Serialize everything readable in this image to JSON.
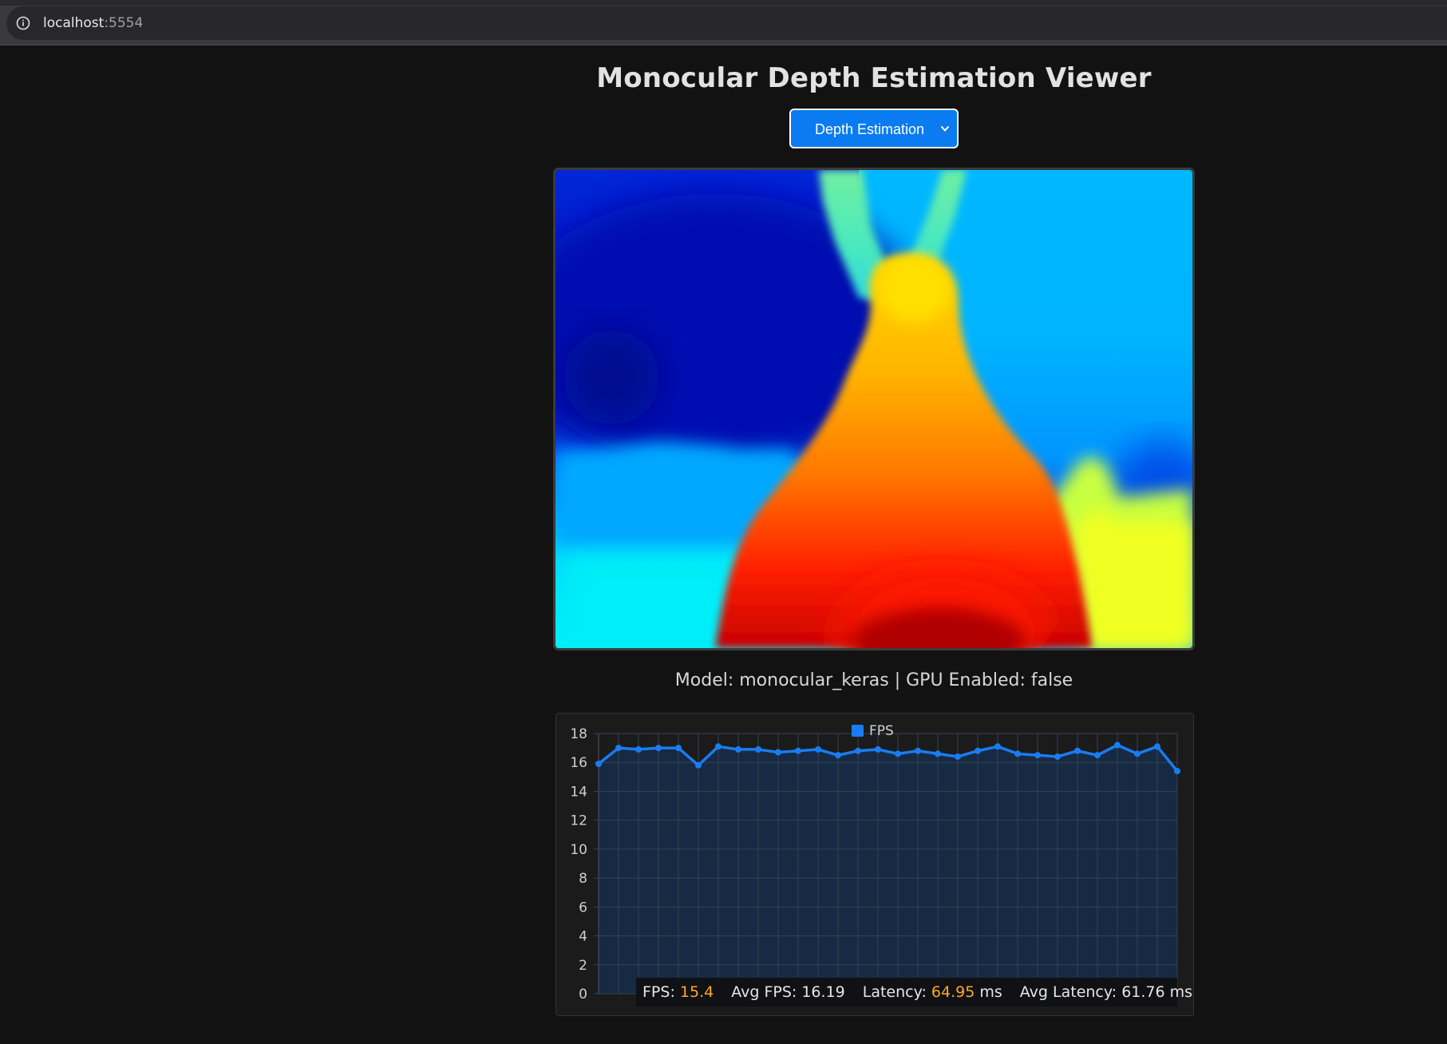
{
  "browser": {
    "url_host": "localhost",
    "url_port": ":5554"
  },
  "page": {
    "title": "Monocular Depth Estimation Viewer"
  },
  "mode_select": {
    "selected": "Depth Estimation"
  },
  "model_info": {
    "model_label": "Model:",
    "model_value": "monocular_keras",
    "separator": "|",
    "gpu_label": "GPU Enabled:",
    "gpu_value": "false"
  },
  "stats": {
    "fps_label": "FPS:",
    "fps_value": "15.4",
    "avg_fps_label": "Avg FPS:",
    "avg_fps_value": "16.19",
    "latency_label": "Latency:",
    "latency_value": "64.95",
    "latency_unit": "ms",
    "avg_latency_label": "Avg Latency:",
    "avg_latency_value": "61.76",
    "avg_latency_unit": "ms",
    "highlight_color": "#ffa726"
  },
  "chart_data": {
    "type": "line",
    "title": "",
    "xlabel": "",
    "ylabel": "",
    "legend": "top-center",
    "grid": true,
    "ylim": [
      0,
      18
    ],
    "yticks": [
      "0",
      "2",
      "4",
      "6",
      "8",
      "10",
      "12",
      "14",
      "16",
      "18"
    ],
    "series": [
      {
        "name": "FPS",
        "color": "#1a7cf0",
        "values": [
          15.9,
          17.0,
          16.9,
          17.0,
          17.0,
          15.8,
          17.1,
          16.9,
          16.9,
          16.7,
          16.8,
          16.9,
          16.5,
          16.8,
          16.9,
          16.6,
          16.8,
          16.6,
          16.4,
          16.8,
          17.1,
          16.6,
          16.5,
          16.4,
          16.8,
          16.5,
          17.2,
          16.6,
          17.1,
          15.4
        ]
      }
    ]
  }
}
